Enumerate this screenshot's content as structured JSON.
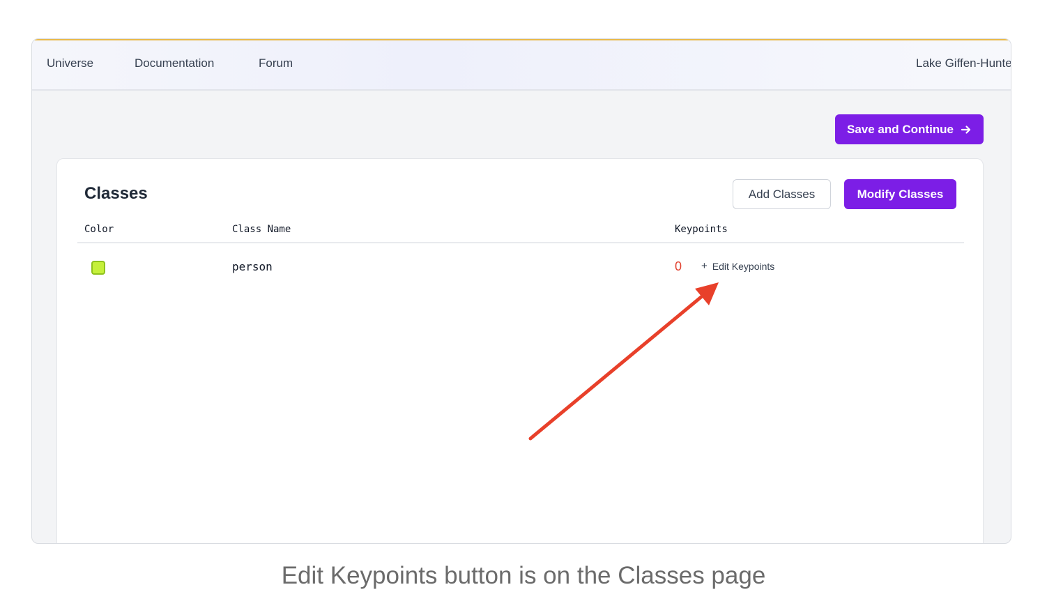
{
  "nav": {
    "links": [
      "Universe",
      "Documentation",
      "Forum"
    ],
    "user": "Lake Giffen-Hunte"
  },
  "toolbar": {
    "save_label": "Save and Continue",
    "save_icon": "arrow-right-icon"
  },
  "classes": {
    "title": "Classes",
    "add_label": "Add Classes",
    "modify_label": "Modify Classes",
    "columns": [
      "Color",
      "Class Name",
      "Keypoints"
    ],
    "rows": [
      {
        "color": "#c5f03a",
        "name": "person",
        "keypoints": "0",
        "edit_label": "Edit Keypoints",
        "edit_icon": "plus-icon"
      }
    ]
  },
  "annotation": {
    "arrow_color": "#e8402a"
  },
  "caption": "Edit Keypoints button is on the Classes page",
  "colors": {
    "accent": "#7c1ee6",
    "keypoint_count": "#e1412f"
  }
}
